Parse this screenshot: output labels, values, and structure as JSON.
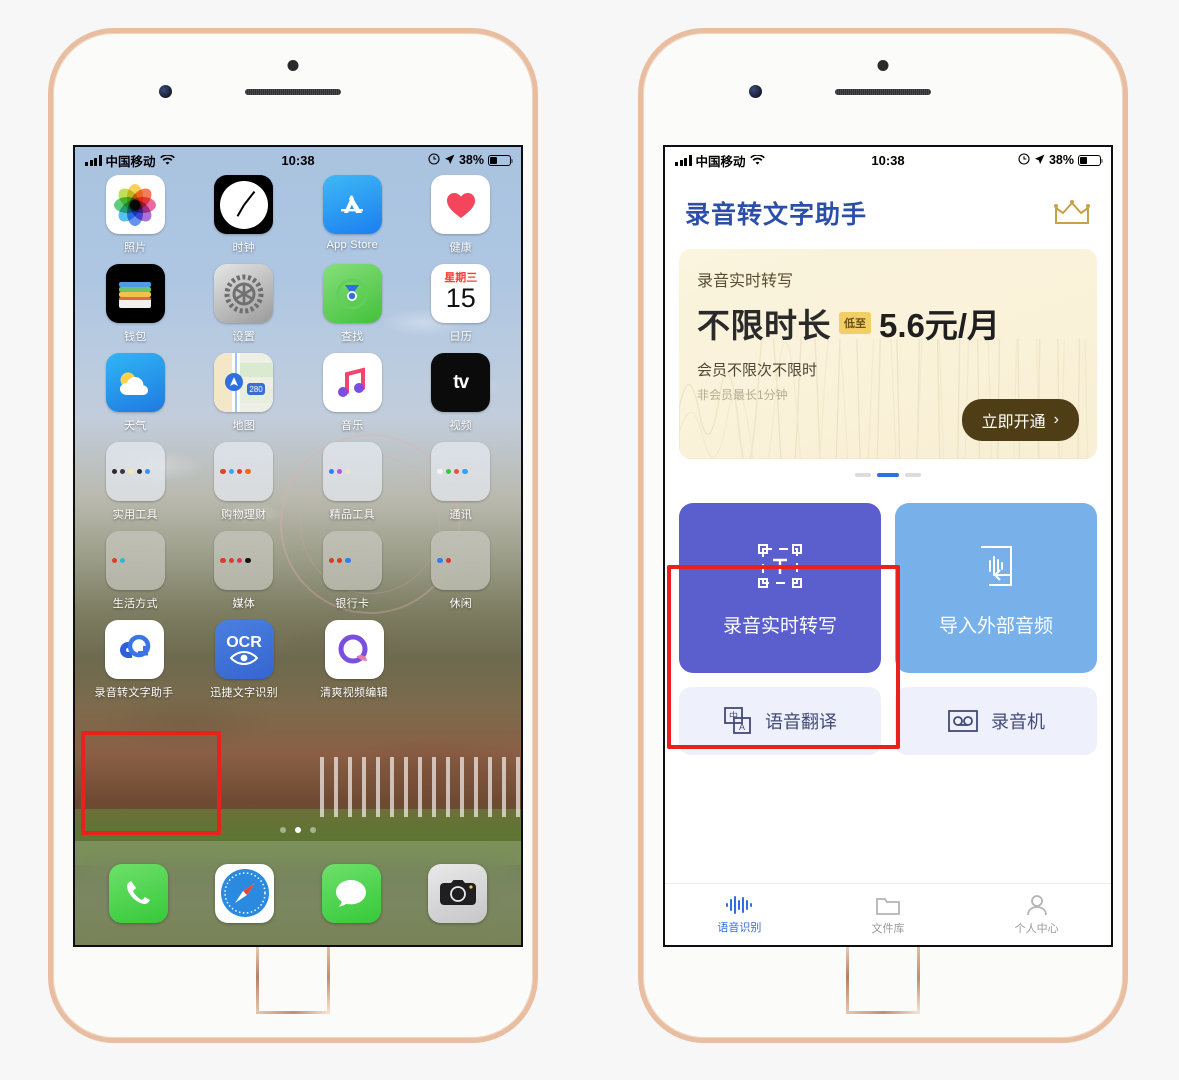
{
  "statusbar": {
    "carrier": "中国移动",
    "time": "10:38",
    "battery_percent": "38%",
    "signal_icon": "signal-bars-icon",
    "wifi_icon": "wifi-icon",
    "alarm_icon": "alarm-icon",
    "location_icon": "location-arrow-icon",
    "battery_icon": "battery-icon"
  },
  "home_screen": {
    "rows": [
      [
        {
          "label": "照片",
          "icon": "photos-icon"
        },
        {
          "label": "时钟",
          "icon": "clock-icon"
        },
        {
          "label": "App Store",
          "icon": "app-store-icon"
        },
        {
          "label": "健康",
          "icon": "health-icon"
        }
      ],
      [
        {
          "label": "钱包",
          "icon": "wallet-icon"
        },
        {
          "label": "设置",
          "icon": "settings-icon"
        },
        {
          "label": "查找",
          "icon": "find-my-icon"
        },
        {
          "label": "日历",
          "icon": "calendar-icon",
          "weekday": "星期三",
          "day": "15"
        }
      ],
      [
        {
          "label": "天气",
          "icon": "weather-icon"
        },
        {
          "label": "地图",
          "icon": "maps-icon"
        },
        {
          "label": "音乐",
          "icon": "music-icon"
        },
        {
          "label": "视频",
          "icon": "apple-tv-icon",
          "glyph": "tv"
        }
      ],
      [
        {
          "label": "实用工具",
          "icon": "folder-icon"
        },
        {
          "label": "购物理财",
          "icon": "folder-icon"
        },
        {
          "label": "精品工具",
          "icon": "folder-icon"
        },
        {
          "label": "通讯",
          "icon": "folder-icon"
        }
      ],
      [
        {
          "label": "生活方式",
          "icon": "folder-icon"
        },
        {
          "label": "媒体",
          "icon": "folder-icon"
        },
        {
          "label": "银行卡",
          "icon": "folder-icon"
        },
        {
          "label": "休闲",
          "icon": "folder-icon"
        }
      ],
      [
        {
          "label": "录音转文字助手",
          "icon": "voice-to-text-app-icon"
        },
        {
          "label": "迅捷文字识别",
          "icon": "ocr-app-icon",
          "glyph": "OCR"
        },
        {
          "label": "清爽视频编辑",
          "icon": "video-editor-app-icon"
        }
      ]
    ],
    "page_dots": 3,
    "active_page": 2,
    "dock": [
      {
        "label": "电话",
        "icon": "phone-icon"
      },
      {
        "label": "Safari",
        "icon": "safari-icon"
      },
      {
        "label": "信息",
        "icon": "messages-icon"
      },
      {
        "label": "相机",
        "icon": "camera-icon"
      }
    ],
    "highlight": {
      "target": "录音转文字助手",
      "color": "#e8221b"
    }
  },
  "app_screen": {
    "title": "录音转文字助手",
    "crown_icon": "crown-icon",
    "banner": {
      "subtitle": "录音实时转写",
      "headline": "不限时长",
      "tag": "低至",
      "price": "5.6元/月",
      "note_primary": "会员不限次不限时",
      "note_secondary": "非会员最长1分钟",
      "cta_label": "立即开通",
      "cta_chevron": "›",
      "cta_color": "#4e3d15",
      "bg_color": "#faf2db",
      "tag_color": "#f2cf65"
    },
    "pager": {
      "count": 3,
      "active": 2,
      "active_color": "#2f6fe0"
    },
    "main_tiles": [
      {
        "label": "录音实时转写",
        "icon": "text-frame-icon",
        "color": "#5b5fce",
        "highlighted": true
      },
      {
        "label": "导入外部音频",
        "icon": "import-audio-icon",
        "color": "#78b1ea",
        "highlighted": false
      }
    ],
    "sub_tiles": [
      {
        "label": "语音翻译",
        "icon": "translate-icon"
      },
      {
        "label": "录音机",
        "icon": "recorder-icon"
      }
    ],
    "tabs": [
      {
        "label": "语音识别",
        "icon": "waveform-icon",
        "active": true
      },
      {
        "label": "文件库",
        "icon": "folder-tab-icon",
        "active": false
      },
      {
        "label": "个人中心",
        "icon": "person-icon",
        "active": false
      }
    ],
    "highlight": {
      "target": "录音实时转写",
      "color": "#e8221b"
    }
  }
}
